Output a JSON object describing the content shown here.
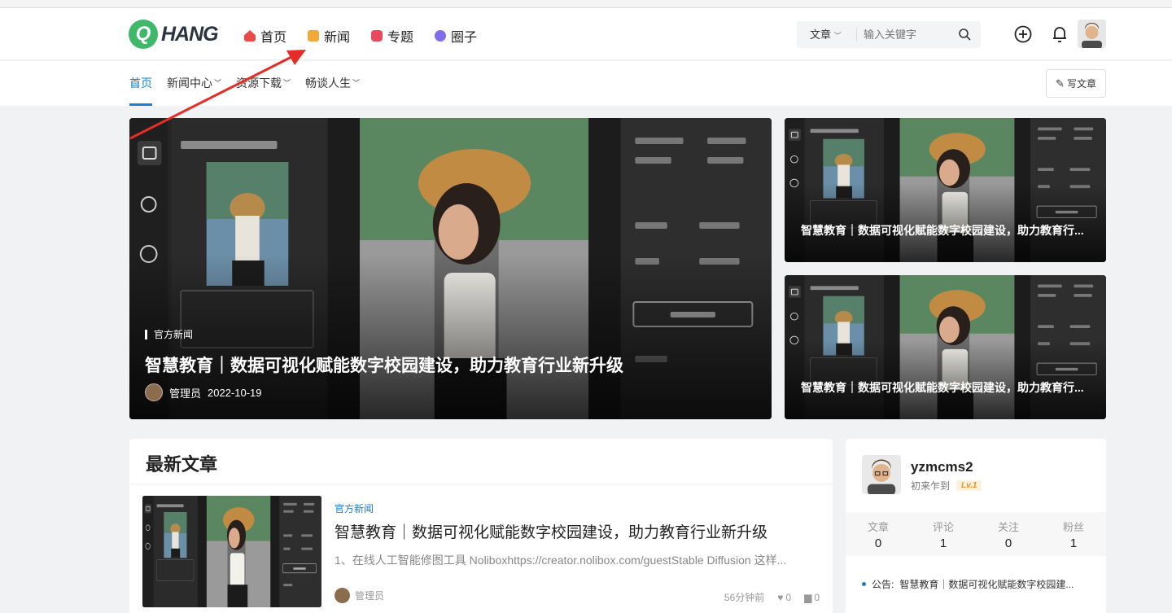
{
  "brand": {
    "logo_letter": "Q",
    "logo_text": "HANG",
    "accent": "#1a7fd4",
    "green": "#3fb86a"
  },
  "nav": {
    "items": [
      {
        "label": "首页",
        "icon": "home-icon",
        "color": "#e94b4b"
      },
      {
        "label": "新闻",
        "icon": "news-icon",
        "color": "#f2a93b"
      },
      {
        "label": "专题",
        "icon": "topic-icon",
        "color": "#e9495c"
      },
      {
        "label": "圈子",
        "icon": "planet-icon",
        "color": "#7f6fe8"
      }
    ]
  },
  "search": {
    "category": "文章",
    "placeholder": "输入关键字"
  },
  "subnav": {
    "items": [
      {
        "label": "首页",
        "active": true
      },
      {
        "label": "新闻中心",
        "dropdown": true
      },
      {
        "label": "资源下载",
        "dropdown": true
      },
      {
        "label": "畅谈人生",
        "dropdown": true
      }
    ],
    "write_label": "写文章"
  },
  "hero": {
    "category": "官方新闻",
    "title": "智慧教育｜数据可视化赋能数字校园建设，助力教育行业新升级",
    "author": "管理员",
    "date": "2022-10-19"
  },
  "side_cards": [
    {
      "title": "智慧教育｜数据可视化赋能数字校园建设，助力教育行..."
    },
    {
      "title": "智慧教育｜数据可视化赋能数字校园建设，助力教育行..."
    }
  ],
  "latest": {
    "heading": "最新文章",
    "article": {
      "category": "官方新闻",
      "title": "智慧教育｜数据可视化赋能数字校园建设，助力教育行业新升级",
      "excerpt": "1、在线人工智能修图工具 Noliboxhttps://creator.nolibox.com/guestStable Diffusion 这样...",
      "author": "管理员",
      "time": "56分钟前",
      "likes": "0",
      "comments": "0"
    }
  },
  "user": {
    "name": "yzmcms2",
    "subtitle": "初来乍到",
    "level": "Lv.1",
    "stats": [
      {
        "label": "文章",
        "value": "0"
      },
      {
        "label": "评论",
        "value": "1"
      },
      {
        "label": "关注",
        "value": "0"
      },
      {
        "label": "粉丝",
        "value": "1"
      }
    ],
    "notice_label": "公告:",
    "notice_text": "智慧教育｜数据可视化赋能数字校园建..."
  }
}
